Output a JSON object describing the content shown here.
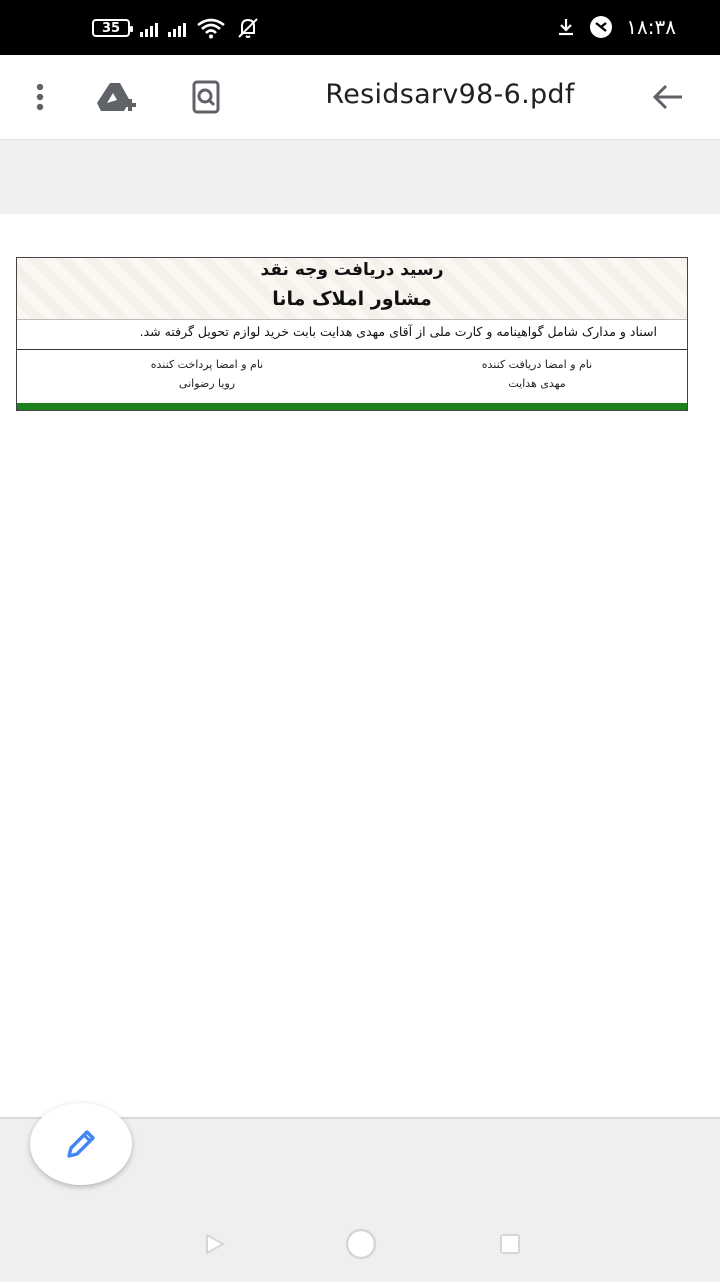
{
  "status_bar": {
    "battery": "35",
    "time": "۱۸:۳۸"
  },
  "toolbar": {
    "title": "Residsarv98-6.pdf",
    "icons": [
      "more-vert-icon",
      "drive-add-icon",
      "find-in-page-icon",
      "back-arrow-icon"
    ]
  },
  "document": {
    "receipt_title": "رسید دریافت وجه نقد",
    "company": "مشاور املاک مانا",
    "body_text": "اسناد و مدارک شامل گواهینامه و کارت ملی  از آقای مهدی هدایت  بابت خرید لوازم تحویل گرفته شد.",
    "receiver_label": "نام و امضا دریافت کننده",
    "receiver_name": "مهدی هدایت",
    "payer_label": "نام و امضا پرداخت کننده",
    "payer_name": "رویا رضوانی"
  },
  "fab": {
    "icon": "edit-pencil-icon",
    "color": "#4285f4"
  },
  "nav": [
    "back-icon",
    "home-icon",
    "recents-icon"
  ]
}
